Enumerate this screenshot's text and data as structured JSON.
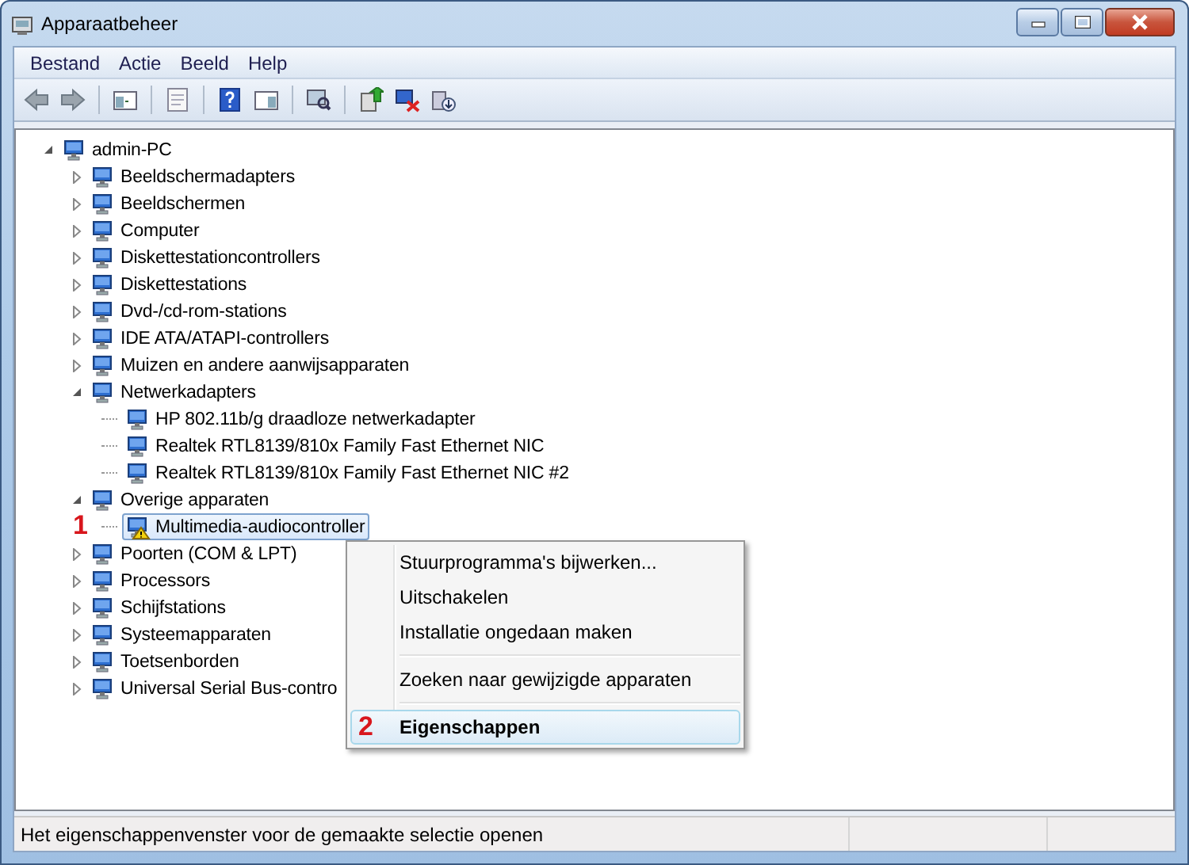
{
  "window": {
    "title": "Apparaatbeheer"
  },
  "menu_bar": [
    {
      "label": "Bestand"
    },
    {
      "label": "Actie"
    },
    {
      "label": "Beeld"
    },
    {
      "label": "Help"
    }
  ],
  "tree": {
    "label": "admin-PC",
    "expanded": true,
    "selected": false,
    "warning": false,
    "children": [
      {
        "label": "Beeldschermadapters",
        "expanded": false,
        "selected": false,
        "warning": false
      },
      {
        "label": "Beeldschermen",
        "expanded": false,
        "selected": false,
        "warning": false
      },
      {
        "label": "Computer",
        "expanded": false,
        "selected": false,
        "warning": false
      },
      {
        "label": "Diskettestationcontrollers",
        "expanded": false,
        "selected": false,
        "warning": false
      },
      {
        "label": "Diskettestations",
        "expanded": false,
        "selected": false,
        "warning": false
      },
      {
        "label": "Dvd-/cd-rom-stations",
        "expanded": false,
        "selected": false,
        "warning": false
      },
      {
        "label": "IDE ATA/ATAPI-controllers",
        "expanded": false,
        "selected": false,
        "warning": false
      },
      {
        "label": "Muizen en andere aanwijsapparaten",
        "expanded": false,
        "selected": false,
        "warning": false
      },
      {
        "label": "Netwerkadapters",
        "expanded": true,
        "selected": false,
        "warning": false,
        "children": [
          {
            "label": "HP 802.11b/g draadloze netwerkadapter",
            "selected": false,
            "warning": false
          },
          {
            "label": "Realtek RTL8139/810x Family Fast Ethernet NIC",
            "selected": false,
            "warning": false
          },
          {
            "label": "Realtek RTL8139/810x Family Fast Ethernet NIC #2",
            "selected": false,
            "warning": false
          }
        ]
      },
      {
        "label": "Overige apparaten",
        "expanded": true,
        "selected": false,
        "warning": false,
        "children": [
          {
            "label": "Multimedia-audiocontroller",
            "selected": true,
            "warning": true,
            "marker": "1"
          }
        ]
      },
      {
        "label": "Poorten (COM & LPT)",
        "expanded": false,
        "selected": false,
        "warning": false
      },
      {
        "label": "Processors",
        "expanded": false,
        "selected": false,
        "warning": false
      },
      {
        "label": "Schijfstations",
        "expanded": false,
        "selected": false,
        "warning": false
      },
      {
        "label": "Systeemapparaten",
        "expanded": false,
        "selected": false,
        "warning": false
      },
      {
        "label": "Toetsenborden",
        "expanded": false,
        "selected": false,
        "warning": false
      },
      {
        "label": "Universal Serial Bus-contro",
        "expanded": false,
        "selected": false,
        "warning": false
      }
    ]
  },
  "context_menu": [
    {
      "kind": "item",
      "label": "Stuurprogramma's bijwerken...",
      "selected": false,
      "default": false
    },
    {
      "kind": "item",
      "label": "Uitschakelen",
      "selected": false,
      "default": false
    },
    {
      "kind": "item",
      "label": "Installatie ongedaan maken",
      "selected": false,
      "default": false
    },
    {
      "kind": "separator"
    },
    {
      "kind": "item",
      "label": "Zoeken naar gewijzigde apparaten",
      "selected": false,
      "default": false
    },
    {
      "kind": "separator"
    },
    {
      "kind": "item",
      "label": "Eigenschappen",
      "selected": true,
      "default": true,
      "marker": "2"
    }
  ],
  "status_bar": {
    "text": "Het eigenschappenvenster voor de gemaakte selectie openen"
  }
}
